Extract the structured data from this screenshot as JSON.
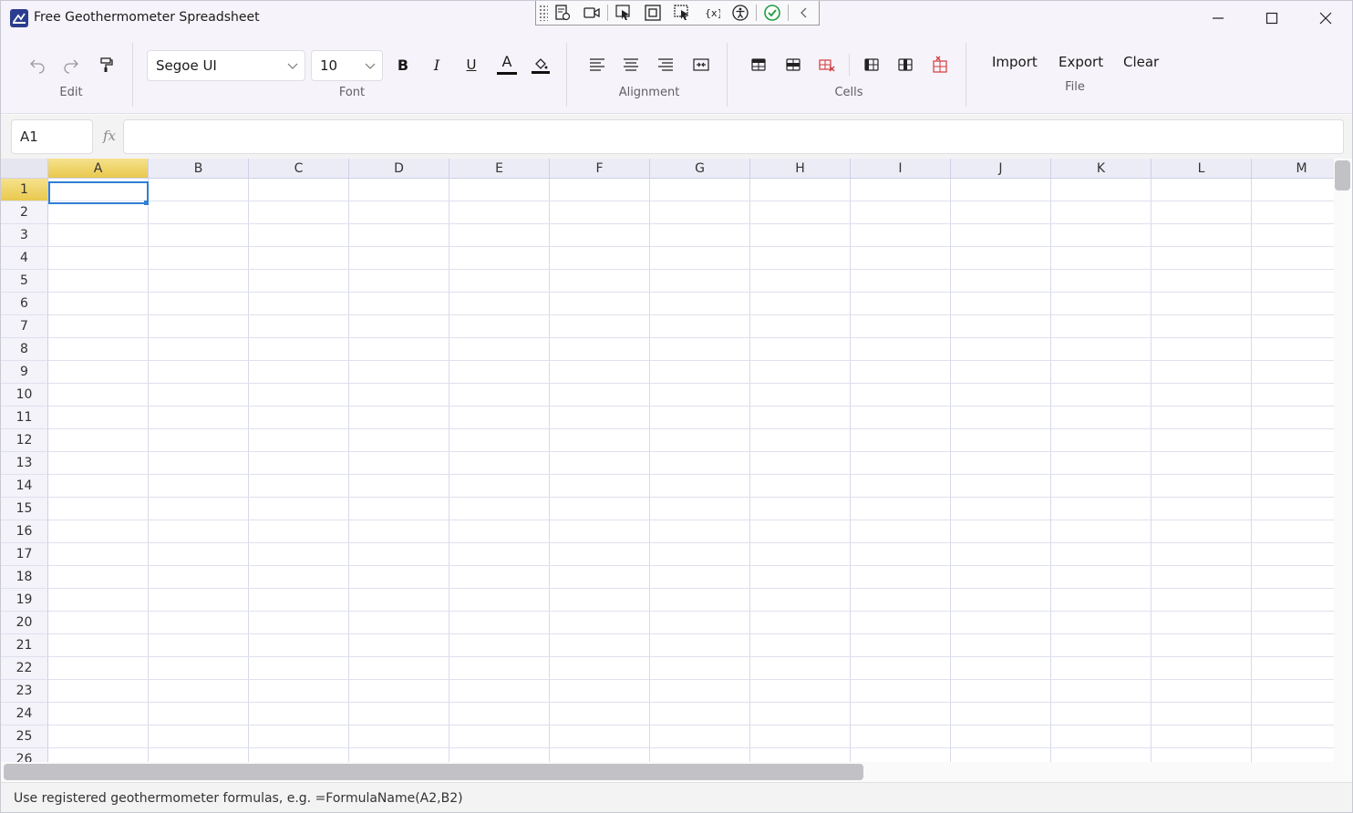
{
  "window": {
    "title": "Free Geothermometer Spreadsheet"
  },
  "devbar": {
    "icons": [
      "live-visual-tree-icon",
      "record-icon",
      "select-element-icon",
      "display-layout-adorners-icon",
      "track-focus-icon",
      "binding-failures-icon",
      "accessibility-icon",
      "hot-reload-ok-icon",
      "collapse-chevron-icon"
    ]
  },
  "ribbon": {
    "groups": {
      "edit": "Edit",
      "font": "Font",
      "alignment": "Alignment",
      "cells": "Cells",
      "file": "File"
    },
    "font_family": "Segoe UI",
    "font_size": "10",
    "bold_label": "B",
    "italic_label": "I",
    "underline_label": "U",
    "font_color_label": "A",
    "import_label": "Import",
    "export_label": "Export",
    "clear_label": "Clear"
  },
  "formula_bar": {
    "name_box": "A1",
    "fx_label": "fx",
    "formula": ""
  },
  "grid": {
    "columns": [
      "A",
      "B",
      "C",
      "D",
      "E",
      "F",
      "G",
      "H",
      "I",
      "J",
      "K",
      "L",
      "M"
    ],
    "rows": [
      "1",
      "2",
      "3",
      "4",
      "5",
      "6",
      "7",
      "8",
      "9",
      "10",
      "11",
      "12",
      "13",
      "14",
      "15",
      "16",
      "17",
      "18",
      "19",
      "20",
      "21",
      "22",
      "23",
      "24",
      "25",
      "26"
    ],
    "active_cell": "A1"
  },
  "status": {
    "text": "Use registered geothermometer formulas, e.g. =FormulaName(A2,B2)"
  },
  "colors": {
    "accent": "#2f7fd4",
    "header_active": "#e8c84e",
    "delete_red": "#d23a3a"
  }
}
